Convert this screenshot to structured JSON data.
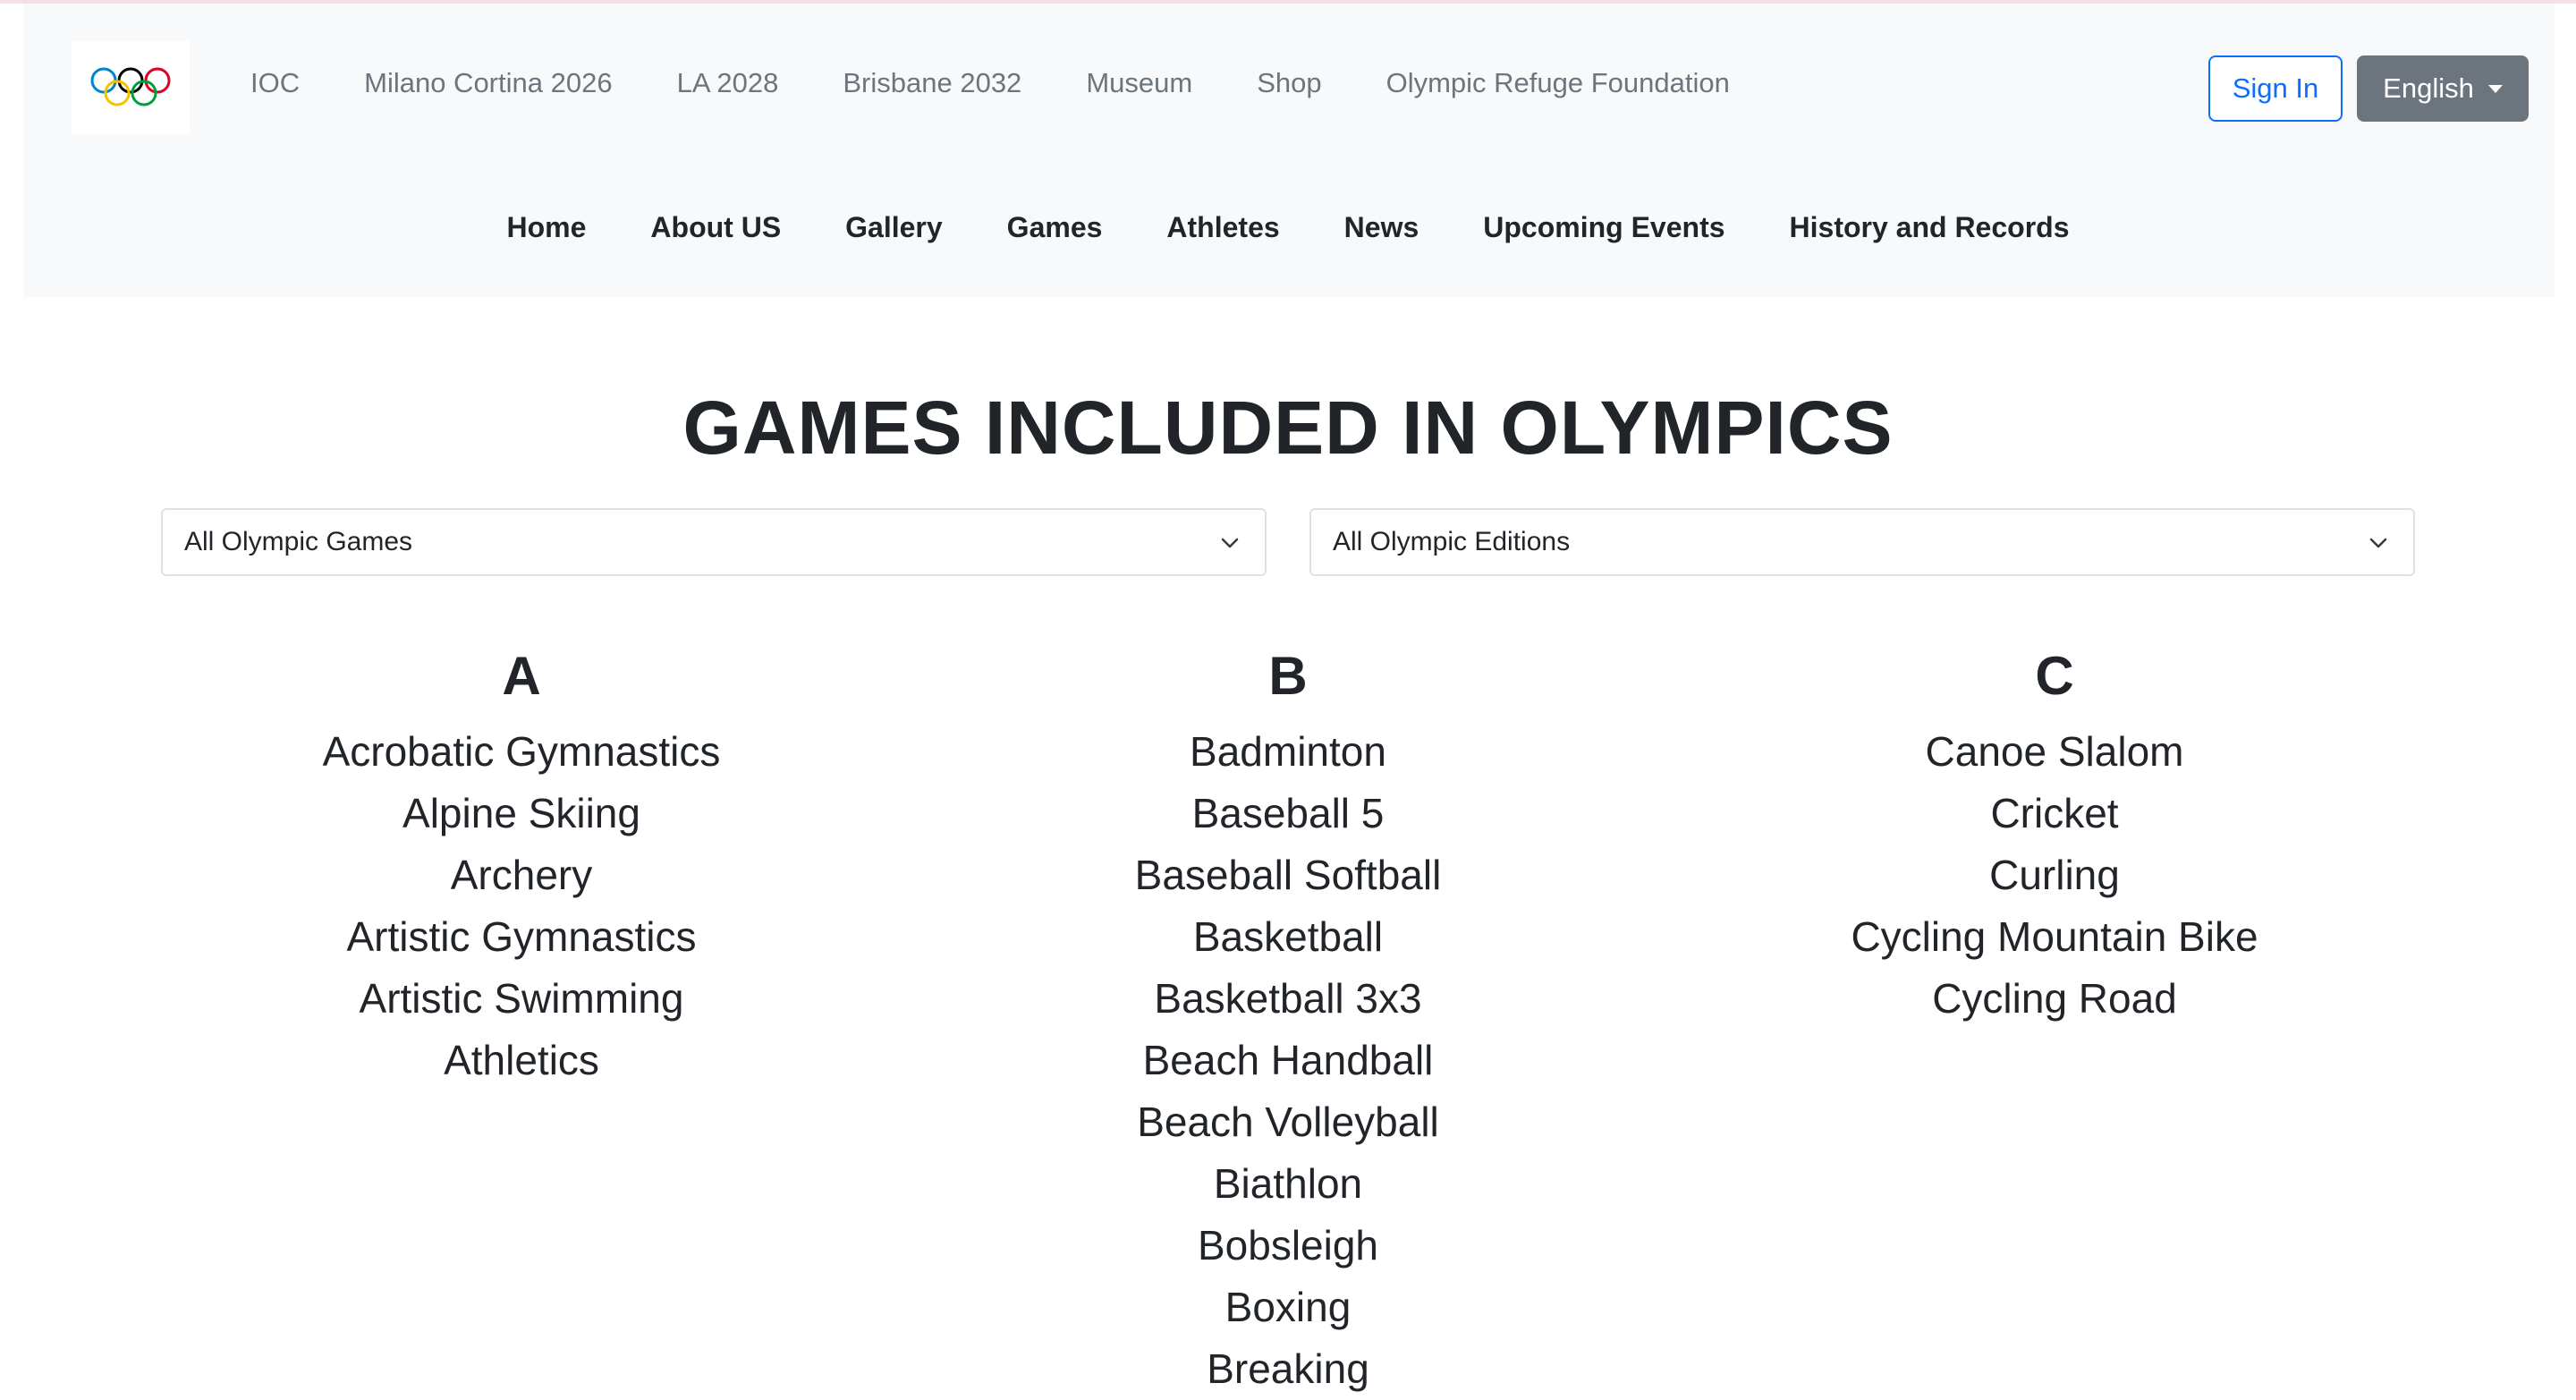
{
  "header": {
    "logo_name": "olympic-rings",
    "ring_colors": [
      "#0085c7",
      "#f4c300",
      "#000000",
      "#009f3d",
      "#df0024"
    ],
    "top_links": [
      "IOC",
      "Milano Cortina 2026",
      "LA 2028",
      "Brisbane 2032",
      "Museum",
      "Shop",
      "Olympic Refuge Foundation"
    ],
    "sign_in_label": "Sign In",
    "language_label": "English",
    "accent_color": "#0d6efd"
  },
  "main_nav": [
    "Home",
    "About US",
    "Gallery",
    "Games",
    "Athletes",
    "News",
    "Upcoming Events",
    "History and Records"
  ],
  "main": {
    "title": "GAMES INCLUDED IN OLYMPICS",
    "filter_games": "All Olympic Games",
    "filter_editions": "All Olympic Editions",
    "columns": [
      {
        "letter": "A",
        "sports": [
          "Acrobatic Gymnastics",
          "Alpine Skiing",
          "Archery",
          "Artistic Gymnastics",
          "Artistic Swimming",
          "Athletics"
        ]
      },
      {
        "letter": "B",
        "sports": [
          "Badminton",
          "Baseball 5",
          "Baseball Softball",
          "Basketball",
          "Basketball 3x3",
          "Beach Handball",
          "Beach Volleyball",
          "Biathlon",
          "Bobsleigh",
          "Boxing",
          "Breaking"
        ]
      },
      {
        "letter": "C",
        "sports": [
          "Canoe Slalom",
          "Cricket",
          "Curling",
          "Cycling Mountain Bike",
          "Cycling Road"
        ]
      }
    ]
  }
}
